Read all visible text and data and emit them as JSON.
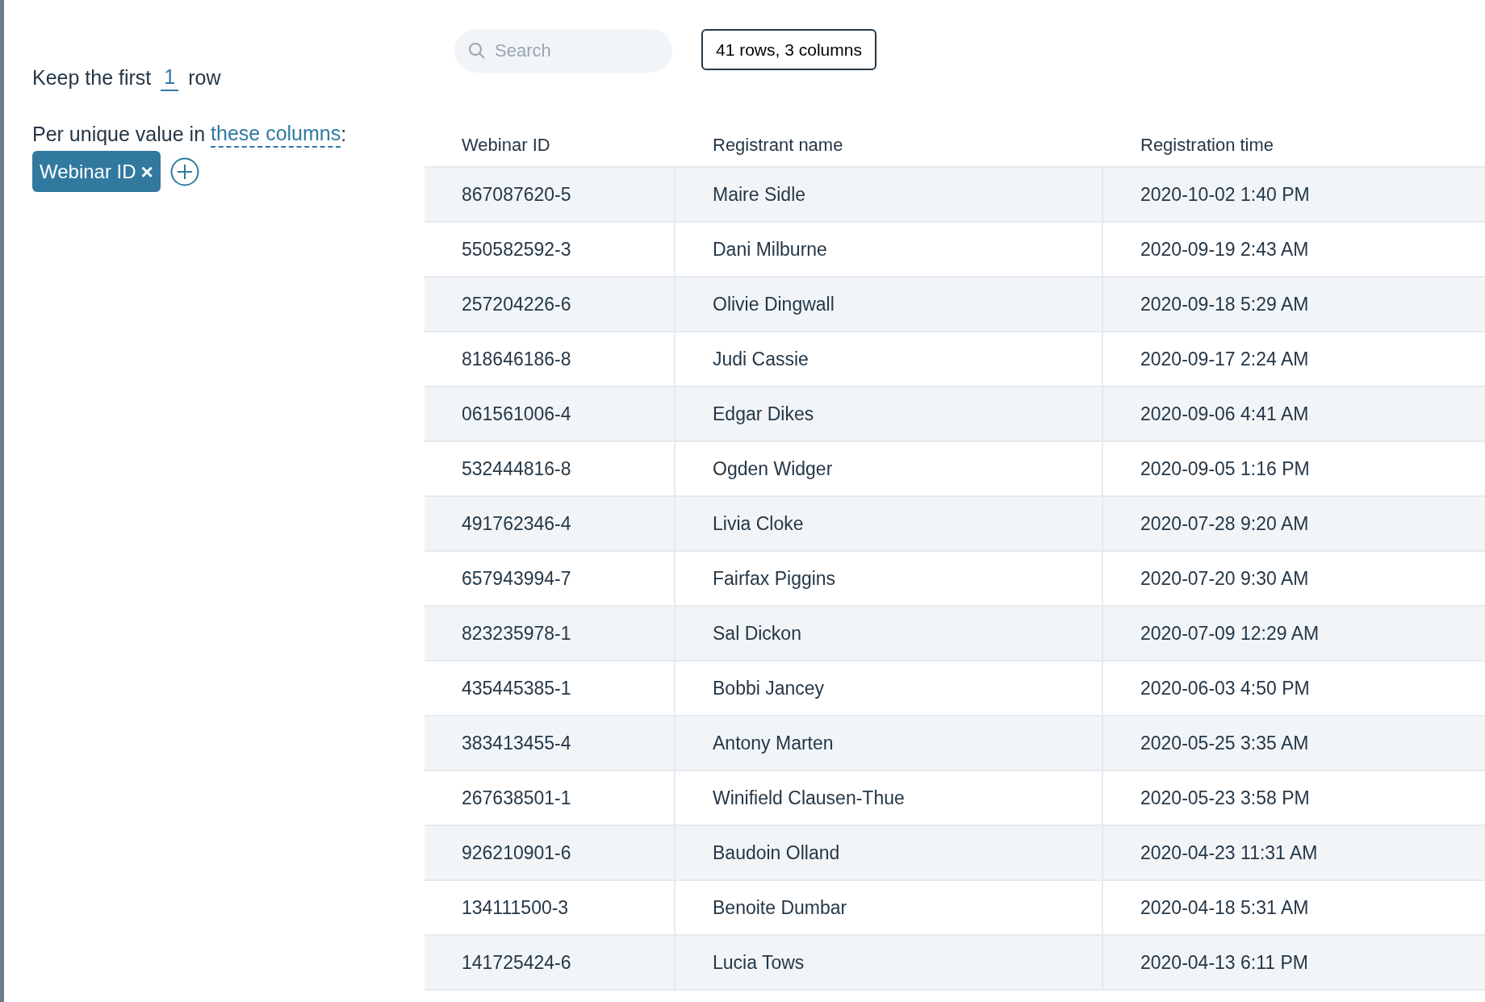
{
  "filter": {
    "prefix": "Keep the first",
    "count": "1",
    "suffix": "row",
    "per_label": "Per unique value in",
    "link": "these columns",
    "colon": ":",
    "chips": [
      {
        "label": "Webinar ID",
        "remove": "×"
      }
    ]
  },
  "search": {
    "placeholder": "Search"
  },
  "summary": "41 rows, 3 columns",
  "table": {
    "columns": [
      "Webinar ID",
      "Registrant name",
      "Registration time"
    ],
    "rows": [
      [
        "867087620-5",
        "Maire Sidle",
        "2020-10-02 1:40 PM"
      ],
      [
        "550582592-3",
        "Dani Milburne",
        "2020-09-19 2:43 AM"
      ],
      [
        "257204226-6",
        "Olivie Dingwall",
        "2020-09-18 5:29 AM"
      ],
      [
        "818646186-8",
        "Judi Cassie",
        "2020-09-17 2:24 AM"
      ],
      [
        "061561006-4",
        "Edgar Dikes",
        "2020-09-06 4:41 AM"
      ],
      [
        "532444816-8",
        "Ogden Widger",
        "2020-09-05 1:16 PM"
      ],
      [
        "491762346-4",
        "Livia Cloke",
        "2020-07-28 9:20 AM"
      ],
      [
        "657943994-7",
        "Fairfax Piggins",
        "2020-07-20 9:30 AM"
      ],
      [
        "823235978-1",
        "Sal Dickon",
        "2020-07-09 12:29 AM"
      ],
      [
        "435445385-1",
        "Bobbi Jancey",
        "2020-06-03 4:50 PM"
      ],
      [
        "383413455-4",
        "Antony Marten",
        "2020-05-25 3:35 AM"
      ],
      [
        "267638501-1",
        "Winifield Clausen-Thue",
        "2020-05-23 3:58 PM"
      ],
      [
        "926210901-6",
        "Baudoin Olland",
        "2020-04-23 11:31 AM"
      ],
      [
        "134111500-3",
        "Benoite Dumbar",
        "2020-04-18 5:31 AM"
      ],
      [
        "141725424-6",
        "Lucia Tows",
        "2020-04-13 6:11 PM"
      ]
    ]
  }
}
